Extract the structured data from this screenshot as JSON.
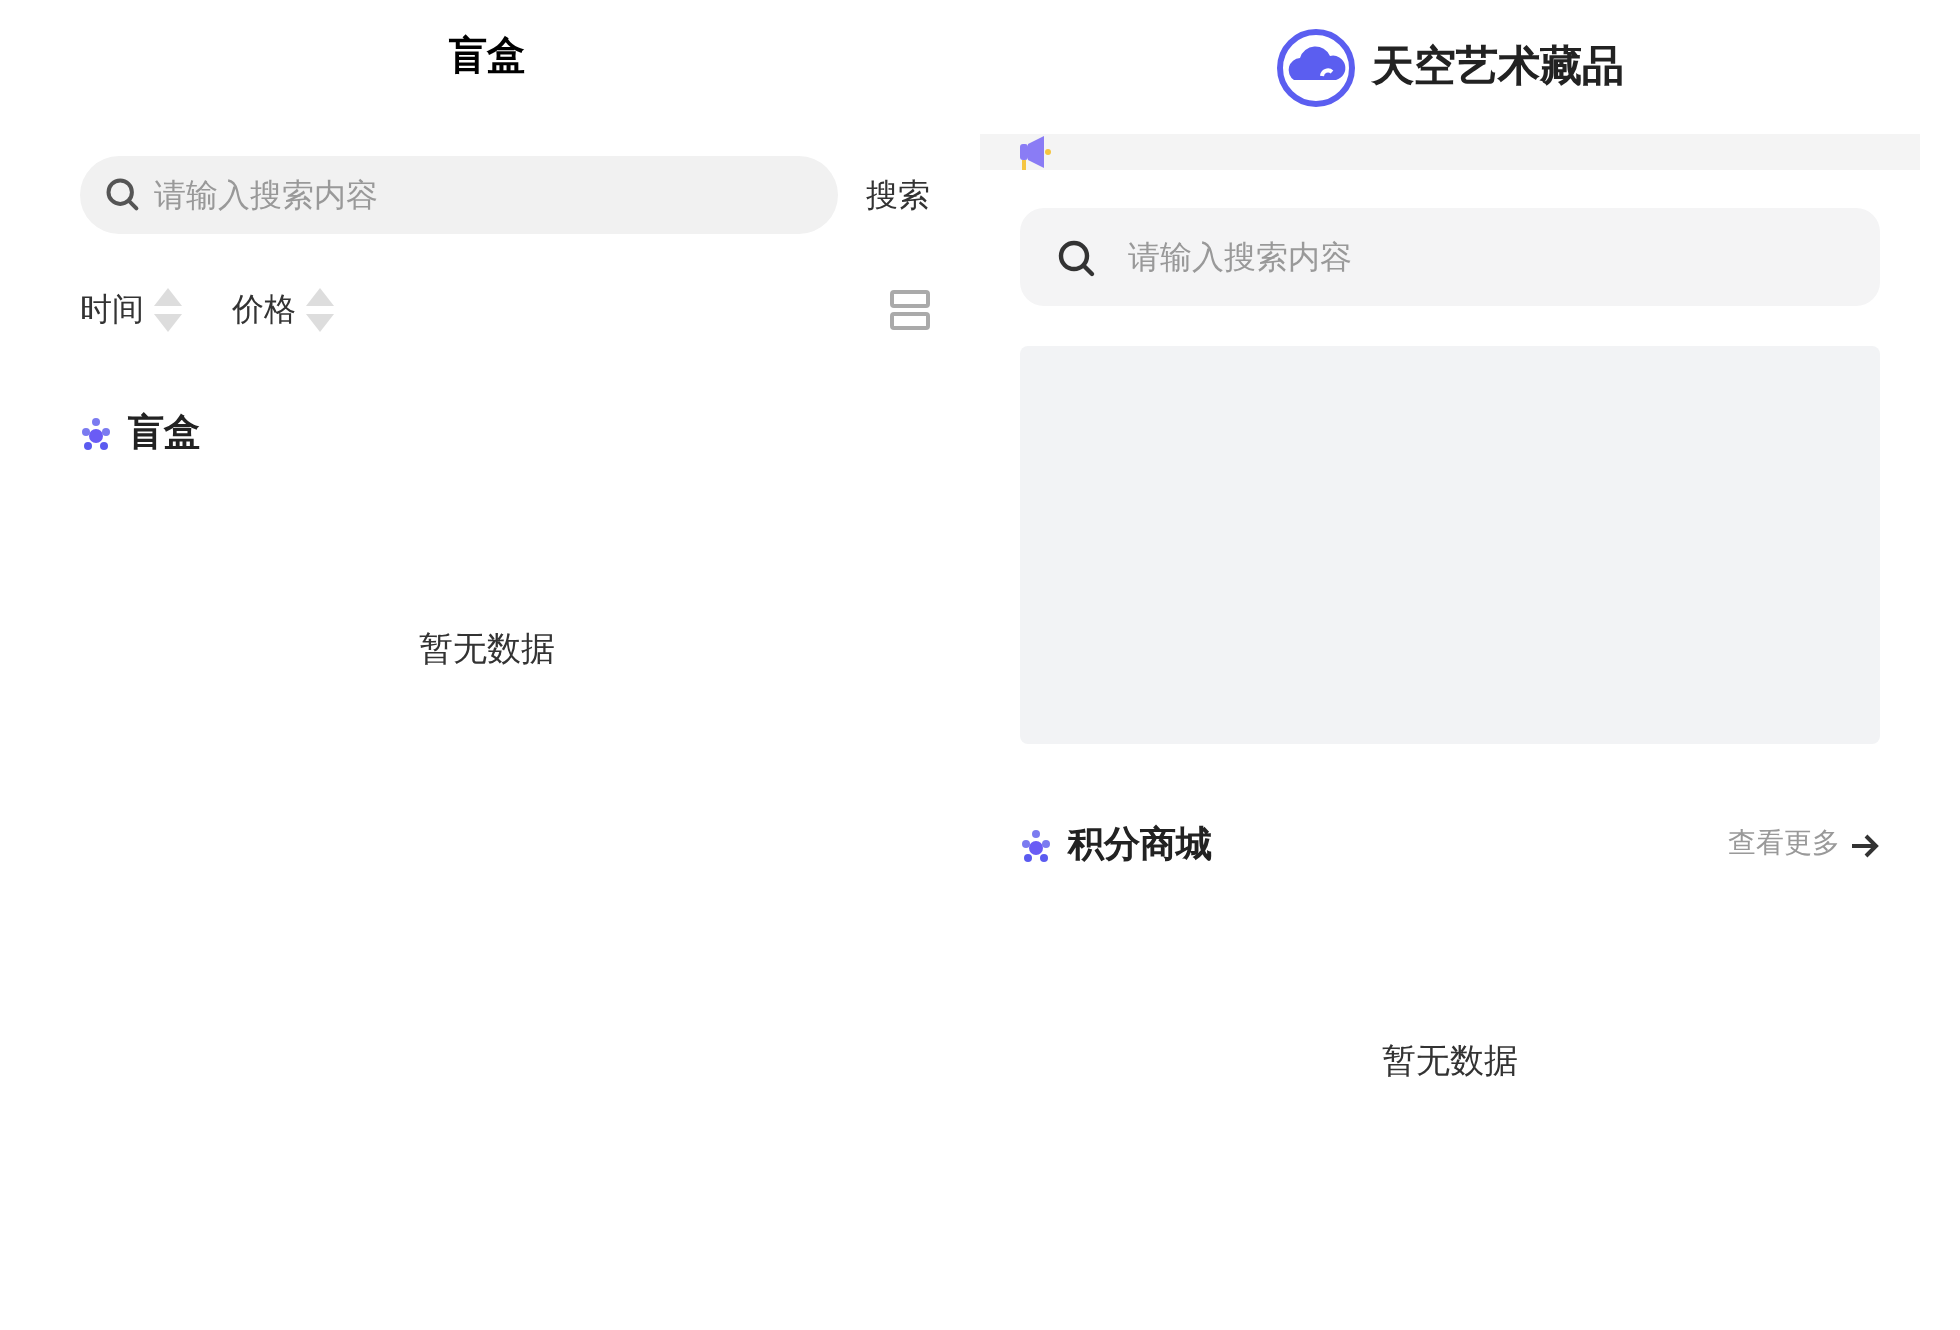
{
  "left": {
    "title": "盲盒",
    "search": {
      "placeholder": "请输入搜索内容",
      "button": "搜索"
    },
    "sorts": [
      {
        "label": "时间"
      },
      {
        "label": "价格"
      }
    ],
    "section": {
      "title": "盲盒"
    },
    "empty": "暂无数据"
  },
  "right": {
    "brand": "天空艺术藏品",
    "search": {
      "placeholder": "请输入搜索内容"
    },
    "section": {
      "title": "积分商城",
      "more": "查看更多"
    },
    "empty": "暂无数据"
  }
}
